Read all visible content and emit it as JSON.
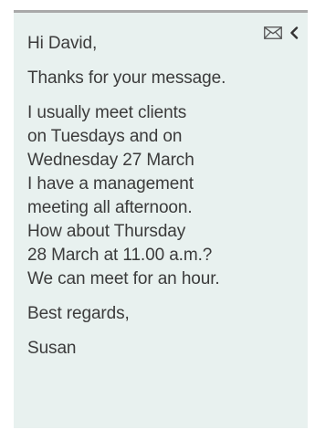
{
  "email": {
    "greeting": "Hi David,",
    "paragraphs": [
      [
        "Thanks for your message."
      ],
      [
        "I usually meet clients",
        "on Tuesdays and on",
        "Wednesday 27 March",
        "I have a management",
        "meeting all afternoon.",
        "How about Thursday",
        "28 March at 11.00 a.m.?",
        "We can meet for an hour."
      ],
      [
        "Best regards,"
      ]
    ],
    "signature": "Susan"
  },
  "icons": {
    "mail": "envelope-icon",
    "back": "chevron-left-icon"
  }
}
